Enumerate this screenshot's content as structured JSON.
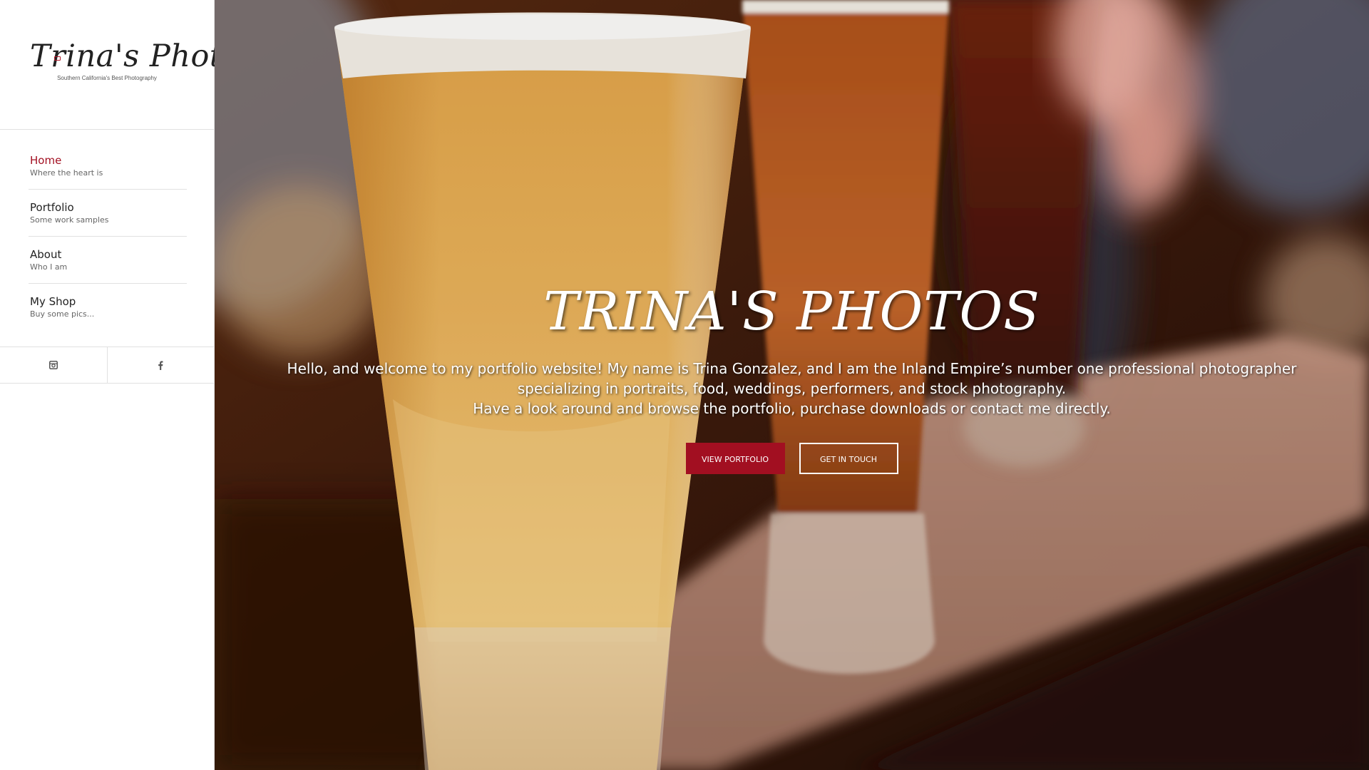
{
  "logo": {
    "title": "Trina's Photos",
    "tagline": "Southern California's Best Photography"
  },
  "nav": {
    "items": [
      {
        "title": "Home",
        "subtitle": "Where the heart is",
        "active": true
      },
      {
        "title": "Portfolio",
        "subtitle": "Some work samples",
        "active": false
      },
      {
        "title": "About",
        "subtitle": "Who I am",
        "active": false
      },
      {
        "title": "My Shop",
        "subtitle": "Buy some pics...",
        "active": false
      }
    ]
  },
  "social": {
    "icons": [
      "instagram-icon",
      "facebook-icon"
    ]
  },
  "hero": {
    "title": "TRINA'S PHOTOS",
    "lines": [
      "Hello, and welcome to my portfolio website! My name is Trina Gonzalez, and I am the Inland Empire’s number one professional photographer",
      "specializing in portraits, food, weddings, performers, and stock photography.",
      "Have a look around and browse the portfolio, purchase downloads or contact me directly."
    ],
    "primary_button": "VIEW PORTFOLIO",
    "secondary_button": "GET IN TOUCH"
  },
  "colors": {
    "accent": "#a20f21",
    "sidebar_bg": "#ffffff",
    "divider": "#e1e1e1",
    "text": "#222222",
    "subtext": "#666666"
  }
}
